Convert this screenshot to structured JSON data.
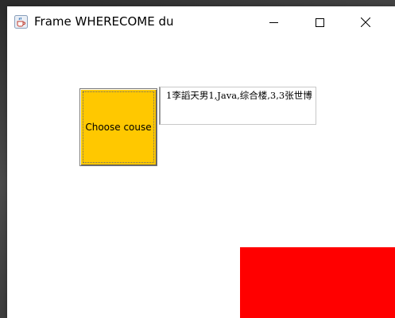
{
  "window": {
    "title": "Frame WHERECOME du",
    "app_icon": "java-cup-icon",
    "controls": {
      "minimize_icon": "minimize-icon",
      "maximize_icon": "maximize-icon",
      "close_icon": "close-icon"
    }
  },
  "content": {
    "choose_button": {
      "label": "Choose couse",
      "color": "#ffc800"
    },
    "text_area": {
      "value": "1李謟天男1,Java,综合楼,3,3张世博"
    },
    "red_panel": {
      "color": "#ff0000"
    }
  }
}
